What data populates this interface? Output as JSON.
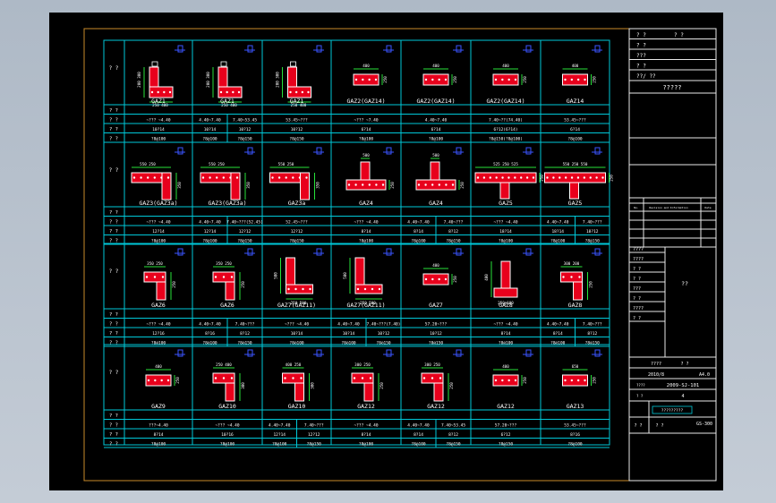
{
  "row_header_label": "? ?",
  "detail_row_label": "? ?",
  "rows": [
    {
      "cells": [
        {
          "name": "GAZ1",
          "r1": "~??? ~4.40",
          "r2": "10?14",
          "r3": "?8@100",
          "shape": "L",
          "dims": [
            "250",
            "400",
            "200",
            "300"
          ]
        },
        {
          "name": "GAZ1",
          "r1": "4.40~7.40",
          "r1b": "7.40~53.45",
          "r2": "10?14",
          "r2b": "10?12",
          "r3": "?8@100",
          "r3b": "?8@150",
          "shape": "L",
          "dims": [
            "250",
            "400",
            "200",
            "300"
          ]
        },
        {
          "name": "GAZ1",
          "r1": "53.45~???",
          "r2": "10?12",
          "r3": "?8@150",
          "shape": "L",
          "dims": [
            "250",
            "400",
            "200",
            "300"
          ]
        },
        {
          "name": "GAZ2(GAZ14)",
          "r1": "~??? ~7.40",
          "r2": "6?14",
          "r3": "?8@100",
          "shape": "I",
          "dims": [
            "400",
            "250"
          ]
        },
        {
          "name": "GAZ2(GAZ14)",
          "r1": "4.40~7.40",
          "r2": "6?14",
          "r3": "?8@100",
          "shape": "I",
          "dims": [
            "400",
            "250"
          ]
        },
        {
          "name": "GAZ2(GAZ14)",
          "r1": "7.40~??(74.40)",
          "r2": "6?12(6?14)",
          "r3": "?8@150(?8@100)",
          "shape": "I",
          "dims": [
            "400",
            "250"
          ]
        },
        {
          "name": "GAZ14",
          "r1": "53.45~???",
          "r2": "6?14",
          "r3": "?8@100",
          "shape": "I",
          "dims": [
            "400",
            "250"
          ]
        }
      ]
    },
    {
      "cells": [
        {
          "name": "GAZ3(GAZ3a)",
          "r1": "~??? ~4.40",
          "r2": "12?14",
          "r3": "?8@100",
          "shape": "T",
          "dims": [
            "550",
            "250",
            "350"
          ]
        },
        {
          "name": "GAZ3(GAZ3a)",
          "r1": "4.40~7.40",
          "r1b": "7.40~???(52.45)",
          "r2": "12?14",
          "r2b": "12?12",
          "r3": "?8@100",
          "r3b": "?8@150",
          "shape": "T",
          "dims": [
            "550",
            "250",
            "350"
          ]
        },
        {
          "name": "GAZ3a",
          "r1": "52.45~???",
          "r2": "12?12",
          "r3": "?8@150",
          "shape": "T",
          "dims": [
            "550",
            "250",
            "350"
          ]
        },
        {
          "name": "GAZ4",
          "r1": "~??? ~4.40",
          "r2": "8?14",
          "r3": "?8@100",
          "shape": "Ti",
          "dims": [
            "500",
            "250"
          ]
        },
        {
          "name": "GAZ4",
          "r1": "4.40~7.40",
          "r1b": "7.40~???",
          "r2": "8?14",
          "r2b": "8?12",
          "r3": "?8@100",
          "r3b": "?8@150",
          "shape": "Ti",
          "dims": [
            "500",
            "250"
          ]
        },
        {
          "name": "GAZ5",
          "r1": "~??? ~4.40",
          "r2": "18?14",
          "r3": "?8@100",
          "shape": "TT",
          "dims": [
            "525",
            "250",
            "525"
          ]
        },
        {
          "name": "GAZ5",
          "r1": "4.40~7.40",
          "r1b": "7.40~???",
          "r2": "18?14",
          "r2b": "18?12",
          "r3": "?8@100",
          "r3b": "?8@150",
          "shape": "TT",
          "dims": [
            "550",
            "250",
            "550"
          ]
        }
      ]
    },
    {
      "cells": [
        {
          "name": "GAZ6",
          "r1": "~??? ~4.40",
          "r2": "12?16",
          "r3": "?8@100",
          "shape": "Lr",
          "dims": [
            "350",
            "250"
          ]
        },
        {
          "name": "GAZ6",
          "r1": "4.40~7.40",
          "r1b": "7.40~???",
          "r2": "8?16",
          "r2b": "8?12",
          "r3": "?8@100",
          "r3b": "?8@150",
          "shape": "Lr",
          "dims": [
            "350",
            "250"
          ]
        },
        {
          "name": "GAZ7(GAZ11)",
          "r1": "~??? ~4.40",
          "r2": "10?14",
          "r3": "?8@100",
          "shape": "Lt",
          "dims": [
            "250",
            "500"
          ]
        },
        {
          "name": "GAZ7(GAZ11)",
          "r1": "4.40~7.40",
          "r1b": "7.40~???(7.40)",
          "r2": "10?14",
          "r2b": "10?12",
          "r3": "?8@100",
          "r3b": "?8@150",
          "shape": "Lt",
          "dims": [
            "250",
            "500"
          ]
        },
        {
          "name": "GAZ7",
          "r1": "57.20~???",
          "r2": "10?12",
          "r3": "?8@150",
          "shape": "I",
          "dims": [
            "400",
            "250"
          ]
        },
        {
          "name": "GAZ8",
          "r1": "~??? ~4.40",
          "r2": "8?14",
          "r3": "?8@100",
          "shape": "Tu",
          "dims": [
            "250",
            "400"
          ]
        },
        {
          "name": "GAZ8",
          "r1": "4.40~7.40",
          "r1b": "7.40~???",
          "r2": "8?14",
          "r2b": "8?12",
          "r3": "?8@100",
          "r3b": "?8@150",
          "shape": "Lr",
          "dims": [
            "300",
            "200"
          ]
        }
      ]
    },
    {
      "cells": [
        {
          "name": "GAZ9",
          "r1": "???~4.40",
          "r2": "8?14",
          "r3": "?8@100",
          "shape": "I",
          "dims": [
            "400",
            "250"
          ]
        },
        {
          "name": "GAZ10",
          "r1": "~??? ~4.40",
          "r2": "10?16",
          "r3": "?8@100",
          "shape": "Lr",
          "dims": [
            "250",
            "400",
            "300"
          ]
        },
        {
          "name": "GAZ10",
          "r1": "4.40~7.40",
          "r1b": "7.40~???",
          "r2": "12?14",
          "r2b": "12?12",
          "r3": "?8@100",
          "r3b": "?8@150",
          "shape": "Lr",
          "dims": [
            "400",
            "250",
            "300"
          ]
        },
        {
          "name": "GAZ12",
          "r1": "~??? ~4.40",
          "r2": "8?14",
          "r3": "?8@100",
          "shape": "Lr",
          "dims": [
            "300",
            "250"
          ]
        },
        {
          "name": "GAZ12",
          "r1": "4.40~7.40",
          "r1b": "7.40~53.45",
          "r2": "8?14",
          "r2b": "8?12",
          "r3": "?8@100",
          "r3b": "?8@150",
          "shape": "Lr",
          "dims": [
            "300",
            "250"
          ]
        },
        {
          "name": "GAZ12",
          "r1": "57.20~???",
          "r2": "6?12",
          "r3": "?8@150",
          "shape": "I",
          "dims": [
            "400",
            "250"
          ]
        },
        {
          "name": "GAZ13",
          "r1": "53.45~???",
          "r2": "8?16",
          "r3": "?8@100",
          "shape": "I",
          "dims": [
            "650",
            "250"
          ]
        }
      ]
    }
  ],
  "titleblock": {
    "top_rows": [
      {
        "a": "? ?",
        "b": "?   ?"
      },
      {
        "a": "? ?",
        "b": ""
      },
      {
        "a": "???",
        "b": ""
      },
      {
        "a": "? ?",
        "b": ""
      },
      {
        "a": "??/ ??",
        "b": ""
      }
    ],
    "project_title": "?????",
    "table_head": [
      "No.",
      "Revision and Information",
      "Date"
    ],
    "signatures": [
      "????",
      "????",
      "? ?",
      "? ?",
      "???",
      "? ?",
      "????",
      "? ?"
    ],
    "drawing_name": "??",
    "date_label": "????",
    "date_value": "2010/8",
    "scale_label": "? ?",
    "scale_value": "A4.0",
    "drawing_no_label": "????",
    "drawing_no": "2009-SJ-101",
    "sheet_label": "? ?",
    "sheet_value": "4",
    "footer_left": "? ?",
    "footer_mid": "? ?",
    "footer_code": "GS-300",
    "stamp": "?????????"
  }
}
